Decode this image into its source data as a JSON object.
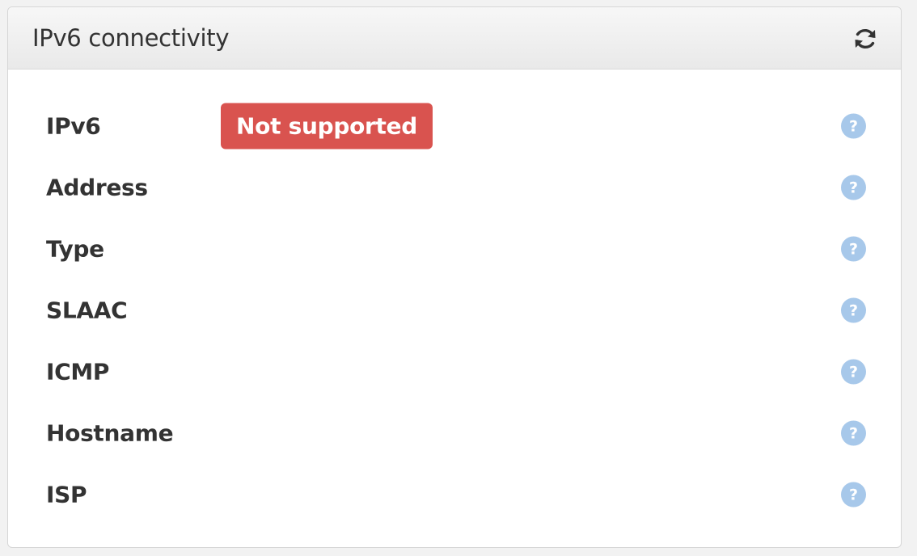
{
  "panel": {
    "title": "IPv6 connectivity",
    "refresh_icon": "refresh-icon"
  },
  "rows": [
    {
      "label": "IPv6",
      "status": "Not supported",
      "status_color": "#d9534f",
      "help_icon": "help-icon"
    },
    {
      "label": "Address",
      "help_icon": "help-icon"
    },
    {
      "label": "Type",
      "help_icon": "help-icon"
    },
    {
      "label": "SLAAC",
      "help_icon": "help-icon"
    },
    {
      "label": "ICMP",
      "help_icon": "help-icon"
    },
    {
      "label": "Hostname",
      "help_icon": "help-icon"
    },
    {
      "label": "ISP",
      "help_icon": "help-icon"
    }
  ]
}
